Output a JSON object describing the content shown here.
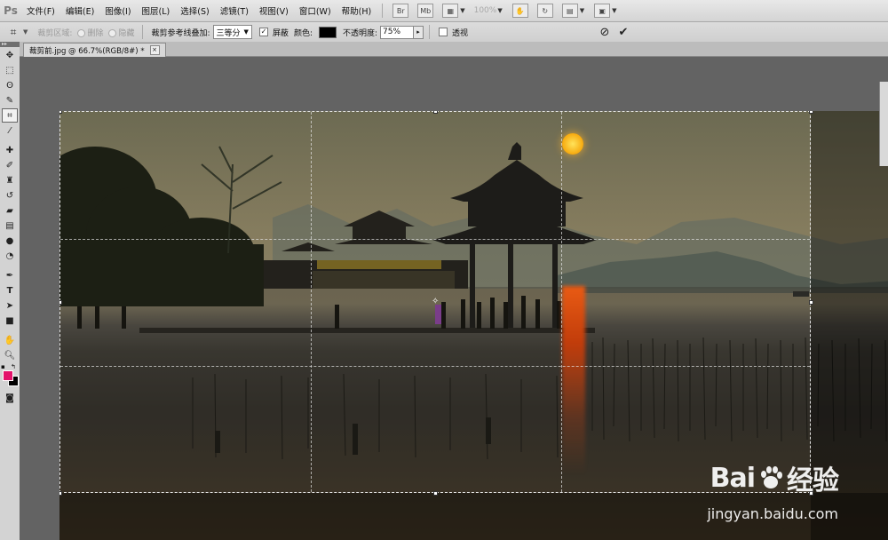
{
  "app": {
    "logo": "Ps"
  },
  "menu": {
    "items": [
      "文件(F)",
      "编辑(E)",
      "图像(I)",
      "图层(L)",
      "选择(S)",
      "滤镜(T)",
      "视图(V)",
      "窗口(W)",
      "帮助(H)"
    ],
    "zoom": "100%"
  },
  "options": {
    "delete_crop_label": "裁剪区域:",
    "delete": "删除",
    "hide": "隐藏",
    "overlay_label": "裁剪参考线叠加:",
    "overlay_value": "三等分",
    "shield_label": "屏蔽",
    "color_label": "颜色:",
    "opacity_label": "不透明度:",
    "opacity_value": "75%",
    "perspective_label": "透视",
    "shield_color": "#000000"
  },
  "document": {
    "tab_title": "裁剪前.jpg @ 66.7%(RGB/8#) *"
  },
  "toolbar": {
    "foreground": "#e3136b",
    "background": "#000000"
  },
  "watermark": {
    "logo_text_1": "Bai",
    "logo_text_2": "经验",
    "url": "jingyan.baidu.com"
  }
}
